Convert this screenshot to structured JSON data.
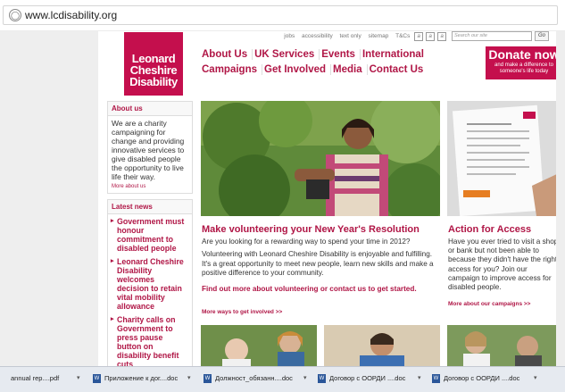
{
  "browser": {
    "url": "www.lcdisability.org"
  },
  "toplinks": {
    "items": [
      "jobs",
      "accessibility",
      "text only",
      "sitemap",
      "T&Cs"
    ],
    "size_buttons": [
      "a",
      "a",
      "a"
    ],
    "search_placeholder": "Search our site",
    "go_label": "Go"
  },
  "logo": {
    "line1": "Leonard",
    "line2": "Cheshire",
    "line3": "Disability"
  },
  "nav": {
    "row1": [
      "About Us",
      "UK Services",
      "Events",
      "International"
    ],
    "row2": [
      "Campaigns",
      "Get Involved",
      "Media",
      "Contact Us"
    ]
  },
  "donate": {
    "title": "Donate now",
    "subtitle": "and make a difference to someone's life today"
  },
  "about": {
    "heading": "About us",
    "text": "We are a charity campaigning for change and providing innovative services to give disabled people the opportunity to live life their way.",
    "more": "More about us"
  },
  "news": {
    "heading": "Latest news",
    "items": [
      "Government must honour commitment to disabled people",
      "Leonard Cheshire Disability welcomes decision to retain vital mobility allowance",
      "Charity calls on Government to press pause button on disability benefit cuts"
    ]
  },
  "feature": {
    "heading": "Make volunteering your New Year's Resolution",
    "line1": "Are you looking for a rewarding way to spend your time in 2012?",
    "para": "Volunteering with Leonard Cheshire Disability is enjoyable and fulfilling. It's a great opportunity to meet new people, learn new skills and make a positive difference to your community.",
    "cta": "Find out more about volunteering or contact us to get started.",
    "more": "More ways to get involved >>"
  },
  "action": {
    "heading": "Action for Access",
    "text": "Have you ever tried to visit a shop or bank but not been able to because they didn't have the right access for you? Join our campaign to improve access for disabled people.",
    "more": "More about our campaigns >>",
    "leaflet_title": "Action for Access"
  },
  "taskbar": {
    "items": [
      "annual rep....pdf",
      "Приложение к дог....doc",
      "Должност_обязанн....doc",
      "Договор с ООРДИ ....doc",
      "Договор с ООРДИ ....doc"
    ]
  },
  "colors": {
    "brand": "#c40f4d",
    "link": "#b01646"
  }
}
